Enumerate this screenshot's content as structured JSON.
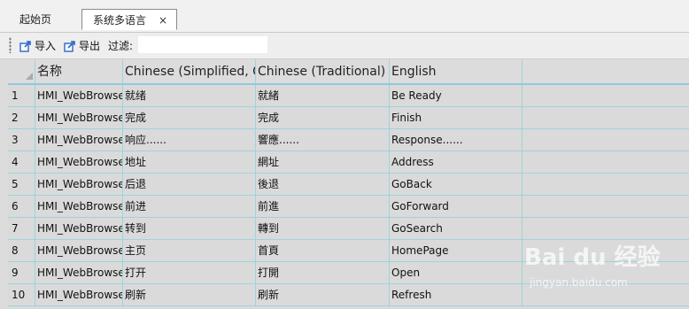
{
  "tabs": [
    {
      "label": "起始页",
      "active": false
    },
    {
      "label": "系统多语言",
      "active": true,
      "close": "×"
    }
  ],
  "toolbar": {
    "import_label": "导入",
    "export_label": "导出",
    "filter_label": "过滤:",
    "filter_value": ""
  },
  "grid": {
    "columns": [
      "名称",
      "Chinese (Simplified, C",
      "Chinese (Traditional)",
      "English",
      ""
    ],
    "rows": [
      {
        "index": "1",
        "name": "HMI_WebBrowse",
        "chs": "就绪",
        "cht": "就緒",
        "en": "Be Ready"
      },
      {
        "index": "2",
        "name": "HMI_WebBrowse",
        "chs": "完成",
        "cht": "完成",
        "en": "Finish"
      },
      {
        "index": "3",
        "name": "HMI_WebBrowse",
        "chs": "响应......",
        "cht": "響應......",
        "en": "Response......"
      },
      {
        "index": "4",
        "name": "HMI_WebBrowse",
        "chs": "地址",
        "cht": "網址",
        "en": "Address"
      },
      {
        "index": "5",
        "name": "HMI_WebBrowse",
        "chs": "后退",
        "cht": "後退",
        "en": "GoBack"
      },
      {
        "index": "6",
        "name": "HMI_WebBrowse",
        "chs": "前进",
        "cht": "前進",
        "en": "GoForward"
      },
      {
        "index": "7",
        "name": "HMI_WebBrowse",
        "chs": "转到",
        "cht": "轉到",
        "en": "GoSearch"
      },
      {
        "index": "8",
        "name": "HMI_WebBrowse",
        "chs": "主页",
        "cht": "首頁",
        "en": "HomePage"
      },
      {
        "index": "9",
        "name": "HMI_WebBrowse",
        "chs": "打开",
        "cht": "打開",
        "en": "Open"
      },
      {
        "index": "10",
        "name": "HMI_WebBrowse",
        "chs": "刷新",
        "cht": "刷新",
        "en": "Refresh"
      }
    ]
  },
  "watermark": {
    "logo": "Bai du 经验",
    "url": "jingyan.baidu.com"
  },
  "colors": {
    "grid_line": "#9fd2df",
    "header_underline": "#8fc8d8",
    "icon_blue": "#2a66c8"
  }
}
